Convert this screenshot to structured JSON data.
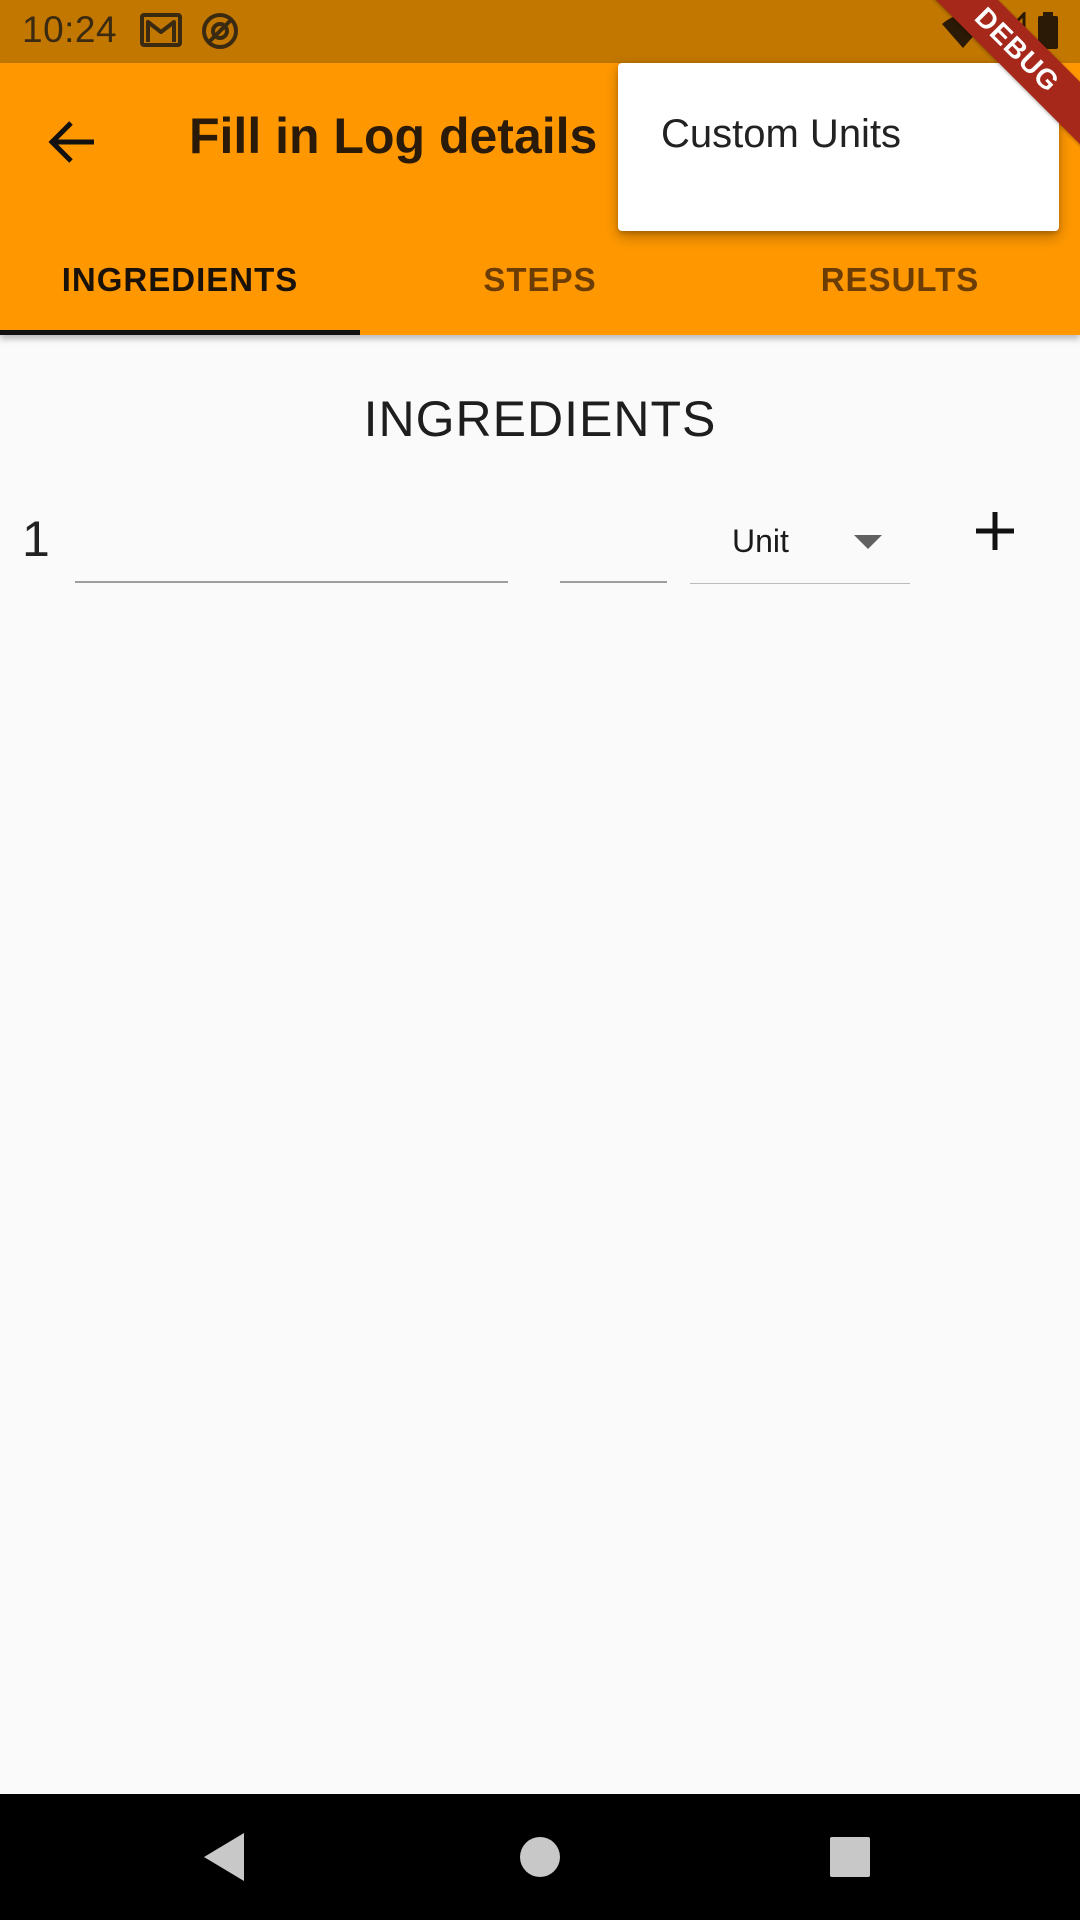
{
  "status_bar": {
    "time": "10:24",
    "icons": [
      "gmail-icon",
      "at-sync-icon",
      "wifi-icon",
      "cell-signal-icon",
      "battery-icon"
    ]
  },
  "app_bar": {
    "title": "Fill in Log details",
    "back_icon": "arrow-back-icon",
    "color": "#ff9800"
  },
  "tabs": [
    {
      "label": "INGREDIENTS",
      "selected": true
    },
    {
      "label": "STEPS",
      "selected": false
    },
    {
      "label": "RESULTS",
      "selected": false
    }
  ],
  "popup_menu": {
    "items": [
      {
        "label": "Custom Units"
      }
    ]
  },
  "debug_banner": {
    "label": "DEBUG",
    "color": "#a6281a"
  },
  "content": {
    "section_heading": "INGREDIENTS",
    "rows": [
      {
        "index": "1",
        "name_value": "",
        "amount_value": "",
        "unit_label": "Unit"
      }
    ],
    "add_icon": "plus-icon"
  },
  "nav_bar": {
    "icons": [
      "nav-back-icon",
      "nav-home-icon",
      "nav-recents-icon"
    ]
  }
}
